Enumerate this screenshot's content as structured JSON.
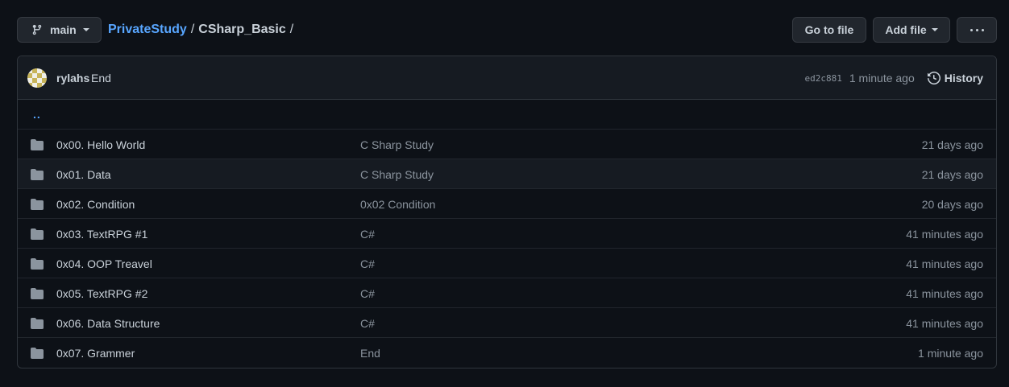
{
  "toolbar": {
    "branch": "main",
    "repo": "PrivateStudy",
    "sep1": "/",
    "folder": "CSharp_Basic",
    "sep2": "/",
    "go_to_file": "Go to file",
    "add_file": "Add file"
  },
  "commit": {
    "author": "rylahs",
    "message": "End",
    "sha": "ed2c881",
    "time": "1 minute ago",
    "history_label": "History"
  },
  "parent_dir": "..",
  "files": [
    {
      "name": "0x00. Hello World",
      "message": "C Sharp Study",
      "age": "21 days ago"
    },
    {
      "name": "0x01. Data",
      "message": "C Sharp Study",
      "age": "21 days ago"
    },
    {
      "name": "0x02. Condition",
      "message": "0x02 Condition",
      "age": "20 days ago"
    },
    {
      "name": "0x03. TextRPG #1",
      "message": "C#",
      "age": "41 minutes ago"
    },
    {
      "name": "0x04. OOP Treavel",
      "message": "C#",
      "age": "41 minutes ago"
    },
    {
      "name": "0x05. TextRPG #2",
      "message": "C#",
      "age": "41 minutes ago"
    },
    {
      "name": "0x06. Data Structure",
      "message": "C#",
      "age": "41 minutes ago"
    },
    {
      "name": "0x07. Grammer",
      "message": "End",
      "age": "1 minute ago"
    }
  ],
  "colors": {
    "background": "#0d1117",
    "link": "#58a6ff",
    "text": "#c9d1d9",
    "muted": "#8b949e",
    "folder": "#8b949e"
  },
  "icons": {
    "branch": "git-branch-icon",
    "history": "history-clock-icon",
    "folder": "folder-icon",
    "more": "kebab-horizontal-icon"
  }
}
